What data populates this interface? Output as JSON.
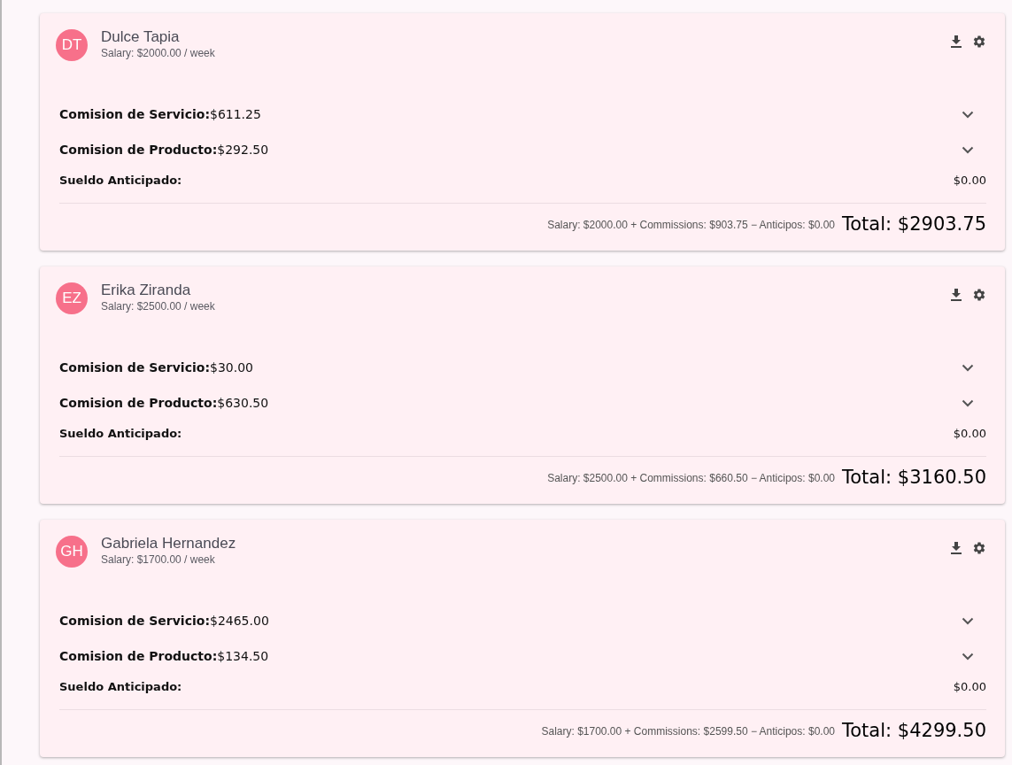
{
  "employees": [
    {
      "initials": "DT",
      "name": "Dulce Tapia",
      "salary": "Salary: $2000.00 / week",
      "lines": [
        {
          "kind": "expandable",
          "expanded": false,
          "label": "Comision de Servicio:",
          "value": "$611.25"
        },
        {
          "kind": "expandable",
          "expanded": false,
          "label": "Comision de Producto:",
          "value": "$292.50"
        },
        {
          "kind": "plain",
          "label": "Sueldo Anticipado:",
          "value": "$0.00"
        }
      ],
      "summary": "Salary: $2000.00 + Commissions: $903.75 − Anticipos: $0.00",
      "total": "Total: $2903.75"
    },
    {
      "initials": "EZ",
      "name": "Erika Ziranda",
      "salary": "Salary: $2500.00 / week",
      "lines": [
        {
          "kind": "expandable",
          "expanded": false,
          "label": "Comision de Servicio:",
          "value": "$30.00"
        },
        {
          "kind": "expandable",
          "expanded": false,
          "label": "Comision de Producto:",
          "value": "$630.50"
        },
        {
          "kind": "plain",
          "label": "Sueldo Anticipado:",
          "value": "$0.00"
        }
      ],
      "summary": "Salary: $2500.00 + Commissions: $660.50 − Anticipos: $0.00",
      "total": "Total: $3160.50"
    },
    {
      "initials": "GH",
      "name": "Gabriela Hernandez",
      "salary": "Salary: $1700.00 / week",
      "lines": [
        {
          "kind": "expandable",
          "expanded": false,
          "label": "Comision de Servicio:",
          "value": "$2465.00"
        },
        {
          "kind": "expandable",
          "expanded": false,
          "label": "Comision de Producto:",
          "value": "$134.50"
        },
        {
          "kind": "plain",
          "label": "Sueldo Anticipado:",
          "value": "$0.00"
        }
      ],
      "summary": "Salary: $1700.00 + Commissions: $2599.50 − Anticipos: $0.00",
      "total": "Total: $4299.50"
    }
  ]
}
